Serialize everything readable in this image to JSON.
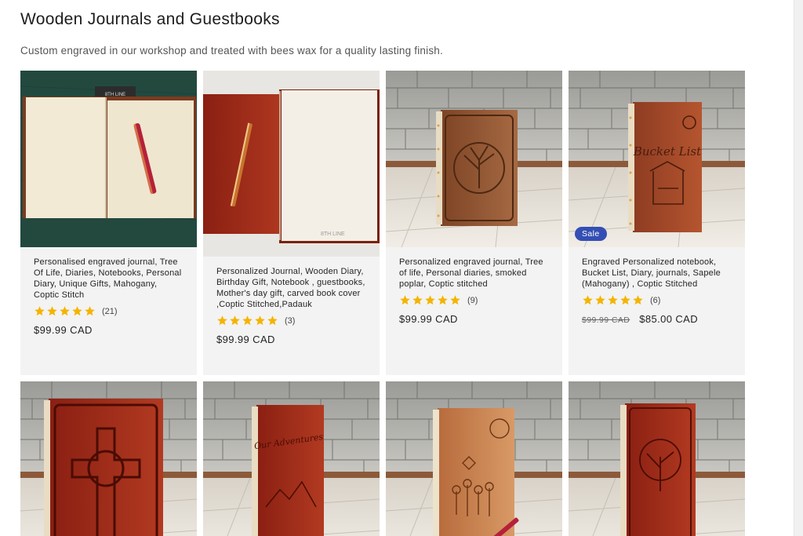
{
  "collection": {
    "title": "Wooden Journals and Guestbooks",
    "description": "Custom engraved in our workshop and treated with bees wax for a quality lasting finish."
  },
  "products": [
    {
      "title": "Personalised engraved journal, Tree Of Life, Diaries, Notebooks, Personal Diary, Unique Gifts, Mahogany, Coptic Stitch",
      "rating": 5,
      "review_count": "(21)",
      "price": "$99.99 CAD",
      "image": "open-journal-with-pen"
    },
    {
      "title": "Personalized Journal, Wooden Diary, Birthday Gift, Notebook , guestbooks, Mother's day gift, carved book cover ,Coptic Stitched,Padauk",
      "rating": 5,
      "review_count": "(3)",
      "price": "$99.99 CAD",
      "image": "open-padauk-journal"
    },
    {
      "title": "Personalized engraved journal, Tree of life, Personal diaries, smoked poplar, Coptic stitched",
      "rating": 5,
      "review_count": "(9)",
      "price": "$99.99 CAD",
      "image": "tree-of-life-journal"
    },
    {
      "title": "Engraved Personalized notebook, Bucket List, Diary, journals, Sapele (Mahogany) , Coptic Stitched",
      "rating": 5,
      "review_count": "(6)",
      "regular_price": "$99.99 CAD",
      "price": "$85.00 CAD",
      "badge": "Sale",
      "image": "bucket-list-journal",
      "cover_text": "Bucket List"
    },
    {
      "image": "celtic-cross-journal"
    },
    {
      "image": "our-adventures-journal",
      "cover_text": "Our Adventures"
    },
    {
      "image": "flowers-butterfly-journal"
    },
    {
      "image": "tree-journal-padauk"
    }
  ],
  "colors": {
    "star": "#f4b400",
    "sale_badge": "#334fb4",
    "card_bg": "#f3f3f3"
  }
}
